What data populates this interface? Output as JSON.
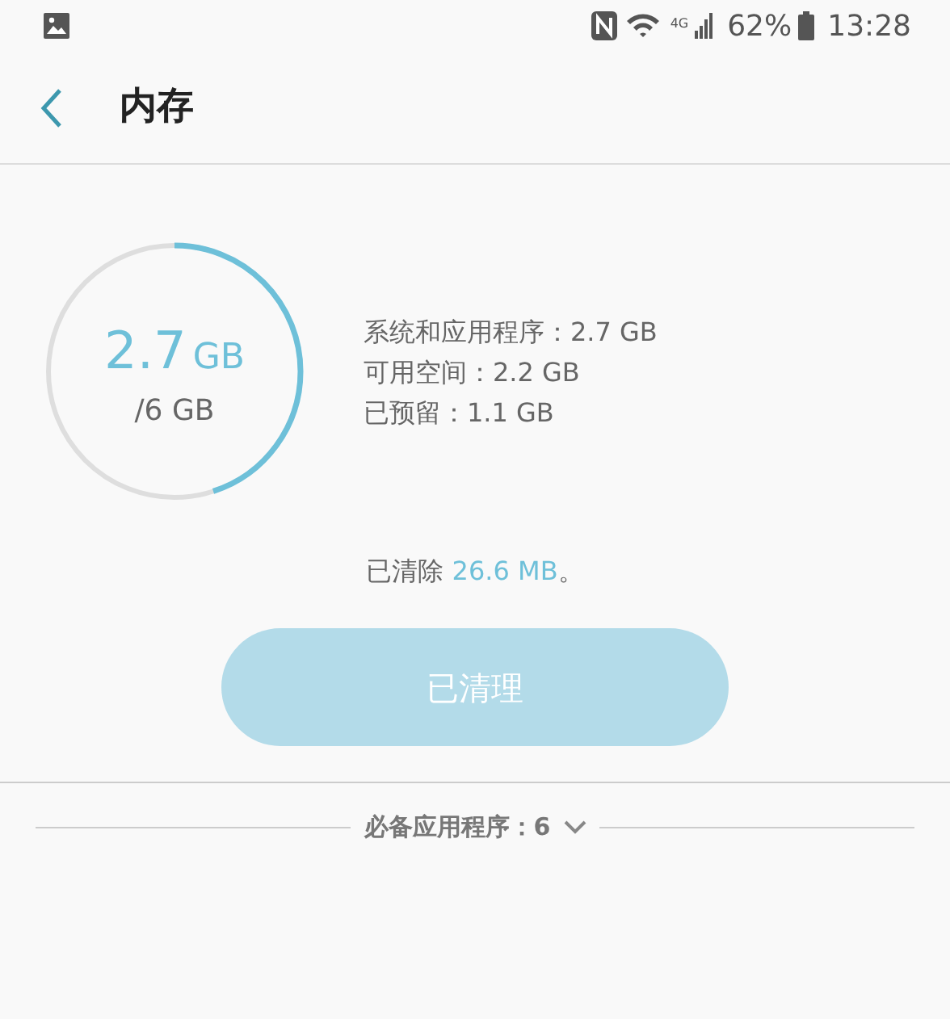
{
  "status_bar": {
    "network_type": "4G",
    "battery": "62%",
    "time": "13:28"
  },
  "header": {
    "title": "内存"
  },
  "usage": {
    "used_value": "2.7",
    "used_unit": "GB",
    "total": "/6 GB"
  },
  "details": [
    "系统和应用程序：2.7 GB",
    "可用空间：2.2 GB",
    "已预留：1.1 GB"
  ],
  "cleared": {
    "prefix": "已清除 ",
    "amount": "26.6 MB",
    "suffix": "。"
  },
  "clean_button": {
    "label": "已清理",
    "disabled": true
  },
  "essential_apps": {
    "label": "必备应用程序：6",
    "expanded": false
  }
}
